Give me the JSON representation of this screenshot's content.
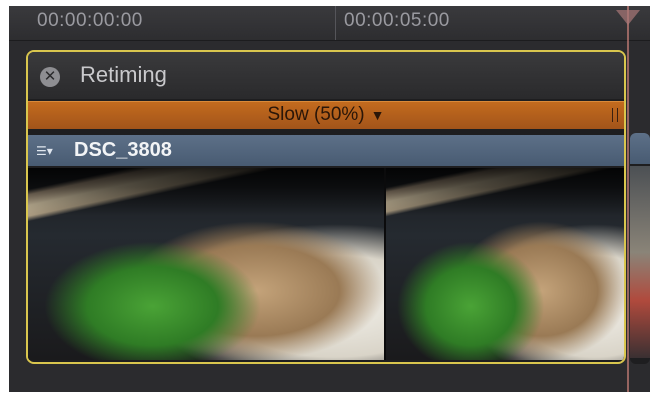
{
  "ruler": {
    "timecodes": [
      "00:00:00:00",
      "00:00:05:00"
    ]
  },
  "retiming": {
    "title": "Retiming",
    "close_icon": "close-icon",
    "speed_label": "Slow (50%)",
    "speed_caret": "▼"
  },
  "clip": {
    "name": "DSC_3808",
    "icon": "clip-menu-icon"
  },
  "colors": {
    "selection_outline": "#d9c64e",
    "retime_slow": "#b35f1c",
    "clip_header": "#55687f"
  }
}
